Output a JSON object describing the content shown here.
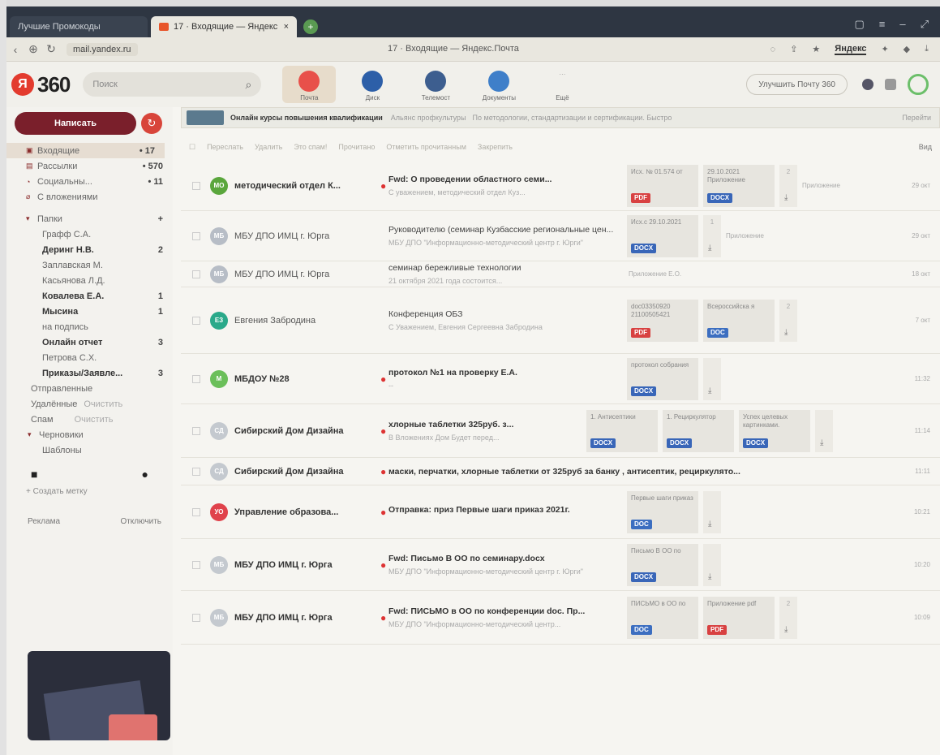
{
  "browser": {
    "tab1": "Лучшие Промокоды",
    "tab2": "17 · Входящие — Яндекс",
    "url": "mail.yandex.ru",
    "page_title": "17 · Входящие — Яндекс.Почта",
    "link": "Яндекс"
  },
  "header": {
    "logo": "360",
    "search_placeholder": "Поиск",
    "services": [
      "Почта",
      "Диск",
      "Телемост",
      "Документы",
      "Ещё"
    ],
    "upgrade": "Улучшить Почту 360"
  },
  "sidebar": {
    "compose": "Написать",
    "folders": [
      {
        "name": "Входящие",
        "count": "• 17",
        "icon": "inbox-icon"
      },
      {
        "name": "Рассылки",
        "count": "• 570",
        "icon": "newsletter-icon"
      },
      {
        "name": "Социальны...",
        "count": "• 11",
        "icon": "social-icon"
      },
      {
        "name": "С вложениями",
        "count": "",
        "icon": "attachment-icon"
      }
    ],
    "folders_header": "Папки",
    "subfolders": [
      {
        "name": "Графф С.А.",
        "count": "",
        "bold": false
      },
      {
        "name": "Деринг Н.В.",
        "count": "2",
        "bold": true
      },
      {
        "name": "Заплавская М.",
        "count": "",
        "bold": false
      },
      {
        "name": "Касьянова Л.Д.",
        "count": "",
        "bold": false
      },
      {
        "name": "Ковалева Е.А.",
        "count": "1",
        "bold": true
      },
      {
        "name": "Мысина",
        "count": "1",
        "bold": true
      },
      {
        "name": "на подпись",
        "count": "",
        "bold": false
      },
      {
        "name": "Онлайн отчет",
        "count": "3",
        "bold": true
      },
      {
        "name": "Петрова С.Х.",
        "count": "",
        "bold": false
      },
      {
        "name": "Приказы/Заявле...",
        "count": "3",
        "bold": true
      }
    ],
    "system": [
      {
        "name": "Отправленные",
        "action": ""
      },
      {
        "name": "Удалённые",
        "action": "Очистить"
      },
      {
        "name": "Спам",
        "action": "Очистить"
      },
      {
        "name": "Черновики",
        "action": ""
      },
      {
        "name": "Шаблоны",
        "action": ""
      }
    ],
    "create_folder": "+ Создать метку",
    "ad_label": "Реклама",
    "ad_hide": "Отключить"
  },
  "banner": {
    "title": "Онлайн курсы повышения квалификации",
    "source": "Альянс профкультуры",
    "text": "По методологии, стандартизации и сертификации. Быстро",
    "action": "Перейти"
  },
  "toolbar": {
    "items": [
      "Переслать",
      "Удалить",
      "Это спам!",
      "Прочитано",
      "Отметить прочитанным",
      "Закрепить"
    ],
    "view": "Вид"
  },
  "emails": [
    {
      "sender": "методический отдел К...",
      "avatar": "МО",
      "color": "#5aa63c",
      "bold": true,
      "unread": true,
      "subject": "Fwd: О проведении областного семи...",
      "snippet": "С уважением, методический отдел Куз...",
      "atts": [
        {
          "name": "Исх. № 01.574 от",
          "type": "PDF"
        },
        {
          "name": "29.10.2021 Приложение",
          "type": "DOCX"
        }
      ],
      "more": "2",
      "dl": "Приложение",
      "date": "29 окт"
    },
    {
      "sender": "МБУ ДПО ИМЦ г. Юрга",
      "avatar": "МБ",
      "color": "#b7bdc6",
      "bold": false,
      "unread": false,
      "subject": "Руководителю (семинар Кузбасские региональные цен...",
      "snippet": "МБУ ДПО \"Информационно-методический центр г. Юрги\"",
      "atts": [
        {
          "name": "Исх.с 29.10.2021",
          "type": "DOCX"
        }
      ],
      "more": "1",
      "dl": "Приложение",
      "date": "29 окт"
    },
    {
      "sender": "МБУ ДПО ИМЦ г. Юрга",
      "avatar": "МБ",
      "color": "#b7bdc6",
      "bold": false,
      "unread": false,
      "subject": "семинар берeжливые технологии",
      "snippet": "21 октября 2021 года состоится...",
      "atts": [],
      "more": "",
      "dl": "Приложение Е.О.",
      "date": "18 окт"
    },
    {
      "sender": "Евгения Забродина",
      "avatar": "ЕЗ",
      "color": "#2aa98a",
      "bold": false,
      "unread": false,
      "subject": "Конференция ОБЗ",
      "snippet": "С Уважением, Евгения Сергеевна Забродина",
      "atts": [
        {
          "name": "doc03350920 21100505421",
          "type": "PDF"
        },
        {
          "name": "Всероссийска я",
          "type": "DOC"
        }
      ],
      "more": "2",
      "dl": "",
      "date": "7 окт"
    },
    {
      "sender": "МБДОУ №28",
      "avatar": "М",
      "color": "#6bbf5a",
      "bold": true,
      "unread": true,
      "subject": "протокол №1 на проверку Е.А.",
      "snippet": "--",
      "atts": [
        {
          "name": "протокол собрания",
          "type": "DOCX"
        }
      ],
      "more": "",
      "dl": "",
      "date": "11:32"
    },
    {
      "sender": "Сибирский Дом Дизайна",
      "avatar": "СД",
      "color": "#c4c9cf",
      "bold": true,
      "unread": true,
      "subject": "хлорные таблетки 325руб. з...",
      "snippet": "В Вложениях Дом Будет перед...",
      "atts": [
        {
          "name": "1. Антисептики",
          "type": "DOCX"
        },
        {
          "name": "1. Рециркулятор",
          "type": "DOCX"
        },
        {
          "name": "Успех целевых картинками.",
          "type": "DOCX"
        }
      ],
      "more": "",
      "dl": "",
      "date": "11:14"
    },
    {
      "sender": "Сибирский Дом Дизайна",
      "avatar": "СД",
      "color": "#c4c9cf",
      "bold": true,
      "unread": true,
      "subject": "маски, перчатки, хлорные таблетки от 325руб за банку , антисептик, рециркулято...",
      "snippet": "",
      "atts": [],
      "more": "",
      "dl": "",
      "date": "11:11"
    },
    {
      "sender": "Управление образова...",
      "avatar": "УО",
      "color": "#e0424b",
      "bold": true,
      "unread": true,
      "subject": "Отправка: приз Первые шаги приказ 2021г.",
      "snippet": "",
      "atts": [
        {
          "name": "Первые шаги приказ",
          "type": "DOC"
        }
      ],
      "more": "",
      "dl": "",
      "date": "10:21"
    },
    {
      "sender": "МБУ ДПО ИМЦ г. Юрга",
      "avatar": "МБ",
      "color": "#c4c9cf",
      "bold": true,
      "unread": true,
      "subject": "Fwd: Письмо В ОО по семинару.docx",
      "snippet": "МБУ ДПО \"Информационно-методический центр г. Юрги\"",
      "atts": [
        {
          "name": "Письмо В ОО по",
          "type": "DOCX"
        }
      ],
      "more": "",
      "dl": "",
      "date": "10:20"
    },
    {
      "sender": "МБУ ДПО ИМЦ г. Юрга",
      "avatar": "МБ",
      "color": "#c4c9cf",
      "bold": true,
      "unread": true,
      "subject": "Fwd: ПИСЬМО в ОО по конференции doc. Пр...",
      "snippet": "МБУ ДПО \"Информационно-методический центр...",
      "atts": [
        {
          "name": "ПИСЬМО в ОО по",
          "type": "DOC"
        },
        {
          "name": "Приложение pdf",
          "type": "PDF"
        }
      ],
      "more": "2",
      "dl": "",
      "date": "10:09"
    }
  ]
}
